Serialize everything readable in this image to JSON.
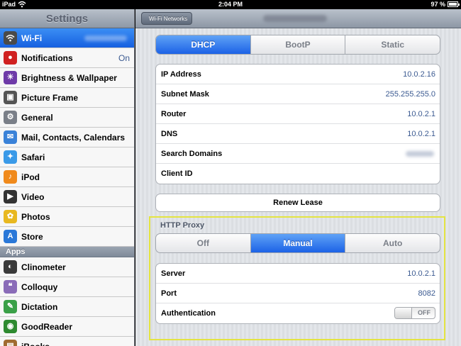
{
  "statusbar": {
    "device": "iPad",
    "time": "2:04 PM",
    "battery": "97 %"
  },
  "sidebar": {
    "title": "Settings",
    "items": [
      {
        "label": "Wi-Fi",
        "value": "",
        "icon": "wifi-icon",
        "color": "#4a4a4a",
        "selected": true
      },
      {
        "label": "Notifications",
        "value": "On",
        "icon": "notifications-icon",
        "color": "#d02020"
      },
      {
        "label": "Brightness & Wallpaper",
        "value": "",
        "icon": "brightness-icon",
        "color": "#6e3aa8"
      },
      {
        "label": "Picture Frame",
        "value": "",
        "icon": "picture-frame-icon",
        "color": "#555"
      },
      {
        "label": "General",
        "value": "",
        "icon": "gear-icon",
        "color": "#7a7f88"
      }
    ],
    "items2": [
      {
        "label": "Mail, Contacts, Calendars",
        "icon": "mail-icon",
        "color": "#3a82d8"
      },
      {
        "label": "Safari",
        "icon": "safari-icon",
        "color": "#3a9ae8"
      },
      {
        "label": "iPod",
        "icon": "ipod-icon",
        "color": "#f08a1c"
      },
      {
        "label": "Video",
        "icon": "video-icon",
        "color": "#333"
      },
      {
        "label": "Photos",
        "icon": "photos-icon",
        "color": "#e8b820"
      },
      {
        "label": "Store",
        "icon": "store-icon",
        "color": "#2a78d8"
      }
    ],
    "apps_header": "Apps",
    "apps": [
      {
        "label": "Clinometer",
        "icon": "clinometer-icon",
        "color": "#3a3a3a"
      },
      {
        "label": "Colloquy",
        "icon": "colloquy-icon",
        "color": "#8a6cb8"
      },
      {
        "label": "Dictation",
        "icon": "dictation-icon",
        "color": "#3aa048"
      },
      {
        "label": "GoodReader",
        "icon": "goodreader-icon",
        "color": "#2e8a30"
      },
      {
        "label": "iBooks",
        "icon": "ibooks-icon",
        "color": "#a06b30"
      }
    ]
  },
  "nav": {
    "back_label": "Wi-Fi Networks"
  },
  "ip_mode": {
    "options": [
      "DHCP",
      "BootP",
      "Static"
    ],
    "selected": "DHCP"
  },
  "ip_rows": [
    {
      "label": "IP Address",
      "value": "10.0.2.16"
    },
    {
      "label": "Subnet Mask",
      "value": "255.255.255.0"
    },
    {
      "label": "Router",
      "value": "10.0.2.1"
    },
    {
      "label": "DNS",
      "value": "10.0.2.1"
    },
    {
      "label": "Search Domains",
      "value": ""
    },
    {
      "label": "Client ID",
      "value": ""
    }
  ],
  "renew_label": "Renew Lease",
  "proxy": {
    "title": "HTTP Proxy",
    "options": [
      "Off",
      "Manual",
      "Auto"
    ],
    "selected": "Manual",
    "rows": [
      {
        "label": "Server",
        "value": "10.0.2.1"
      },
      {
        "label": "Port",
        "value": "8082"
      }
    ],
    "auth_label": "Authentication",
    "auth_toggle": "OFF"
  },
  "colors": {
    "accent": "#1c62e6",
    "highlight": "#e4e442",
    "value_text": "#3b5a91"
  }
}
